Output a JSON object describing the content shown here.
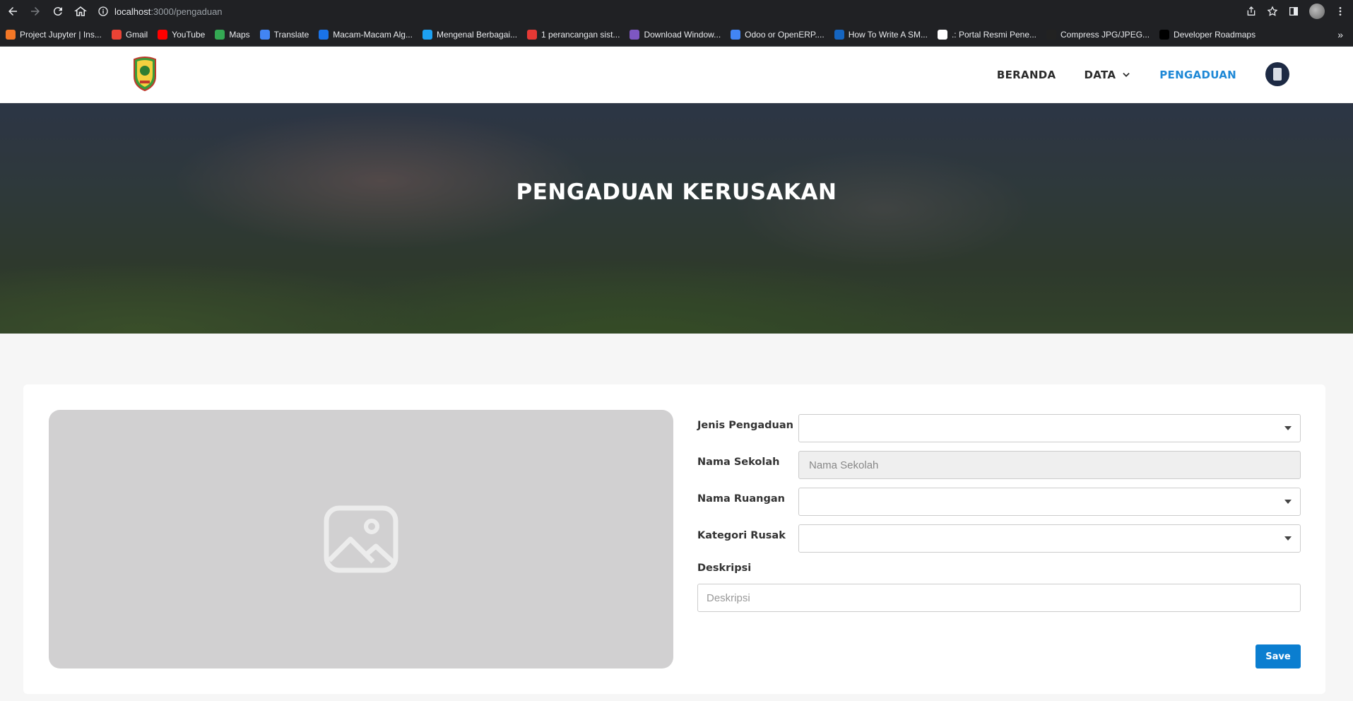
{
  "browser": {
    "url_host": "localhost",
    "url_path": ":3000/pengaduan",
    "bookmarks": [
      {
        "label": "Project Jupyter | Ins...",
        "color": "#f37726"
      },
      {
        "label": "Gmail",
        "color": "#ea4335"
      },
      {
        "label": "YouTube",
        "color": "#ff0000"
      },
      {
        "label": "Maps",
        "color": "#34a853"
      },
      {
        "label": "Translate",
        "color": "#4285f4"
      },
      {
        "label": "Macam-Macam Alg...",
        "color": "#1a73e8"
      },
      {
        "label": "Mengenal Berbagai...",
        "color": "#1da1f2"
      },
      {
        "label": "1 perancangan sist...",
        "color": "#e53935"
      },
      {
        "label": "Download Window...",
        "color": "#7e57c2"
      },
      {
        "label": "Odoo or OpenERP....",
        "color": "#4285f4"
      },
      {
        "label": "How To Write A SM...",
        "color": "#1565c0"
      },
      {
        "label": ".: Portal Resmi Pene...",
        "color": "#ffffff"
      },
      {
        "label": "Compress JPG/JPEG...",
        "color": "#222222"
      },
      {
        "label": "Developer Roadmaps",
        "color": "#000000"
      }
    ],
    "more": "»"
  },
  "navbar": {
    "items": [
      {
        "label": "BERANDA"
      },
      {
        "label": "DATA"
      },
      {
        "label": "PENGADUAN"
      }
    ],
    "active_color": "#1e88d6"
  },
  "hero": {
    "title": "PENGADUAN KERUSAKAN"
  },
  "form": {
    "jenis_label": "Jenis Pengaduan",
    "jenis_value": "",
    "sekolah_label": "Nama Sekolah",
    "sekolah_placeholder": "Nama Sekolah",
    "ruangan_label": "Nama Ruangan",
    "ruangan_value": "",
    "kategori_label": "Kategori Rusak",
    "kategori_value": "",
    "deskripsi_label": "Deskripsi",
    "deskripsi_placeholder": "Deskripsi",
    "save_label": "Save",
    "save_color": "#0b7ed0"
  }
}
